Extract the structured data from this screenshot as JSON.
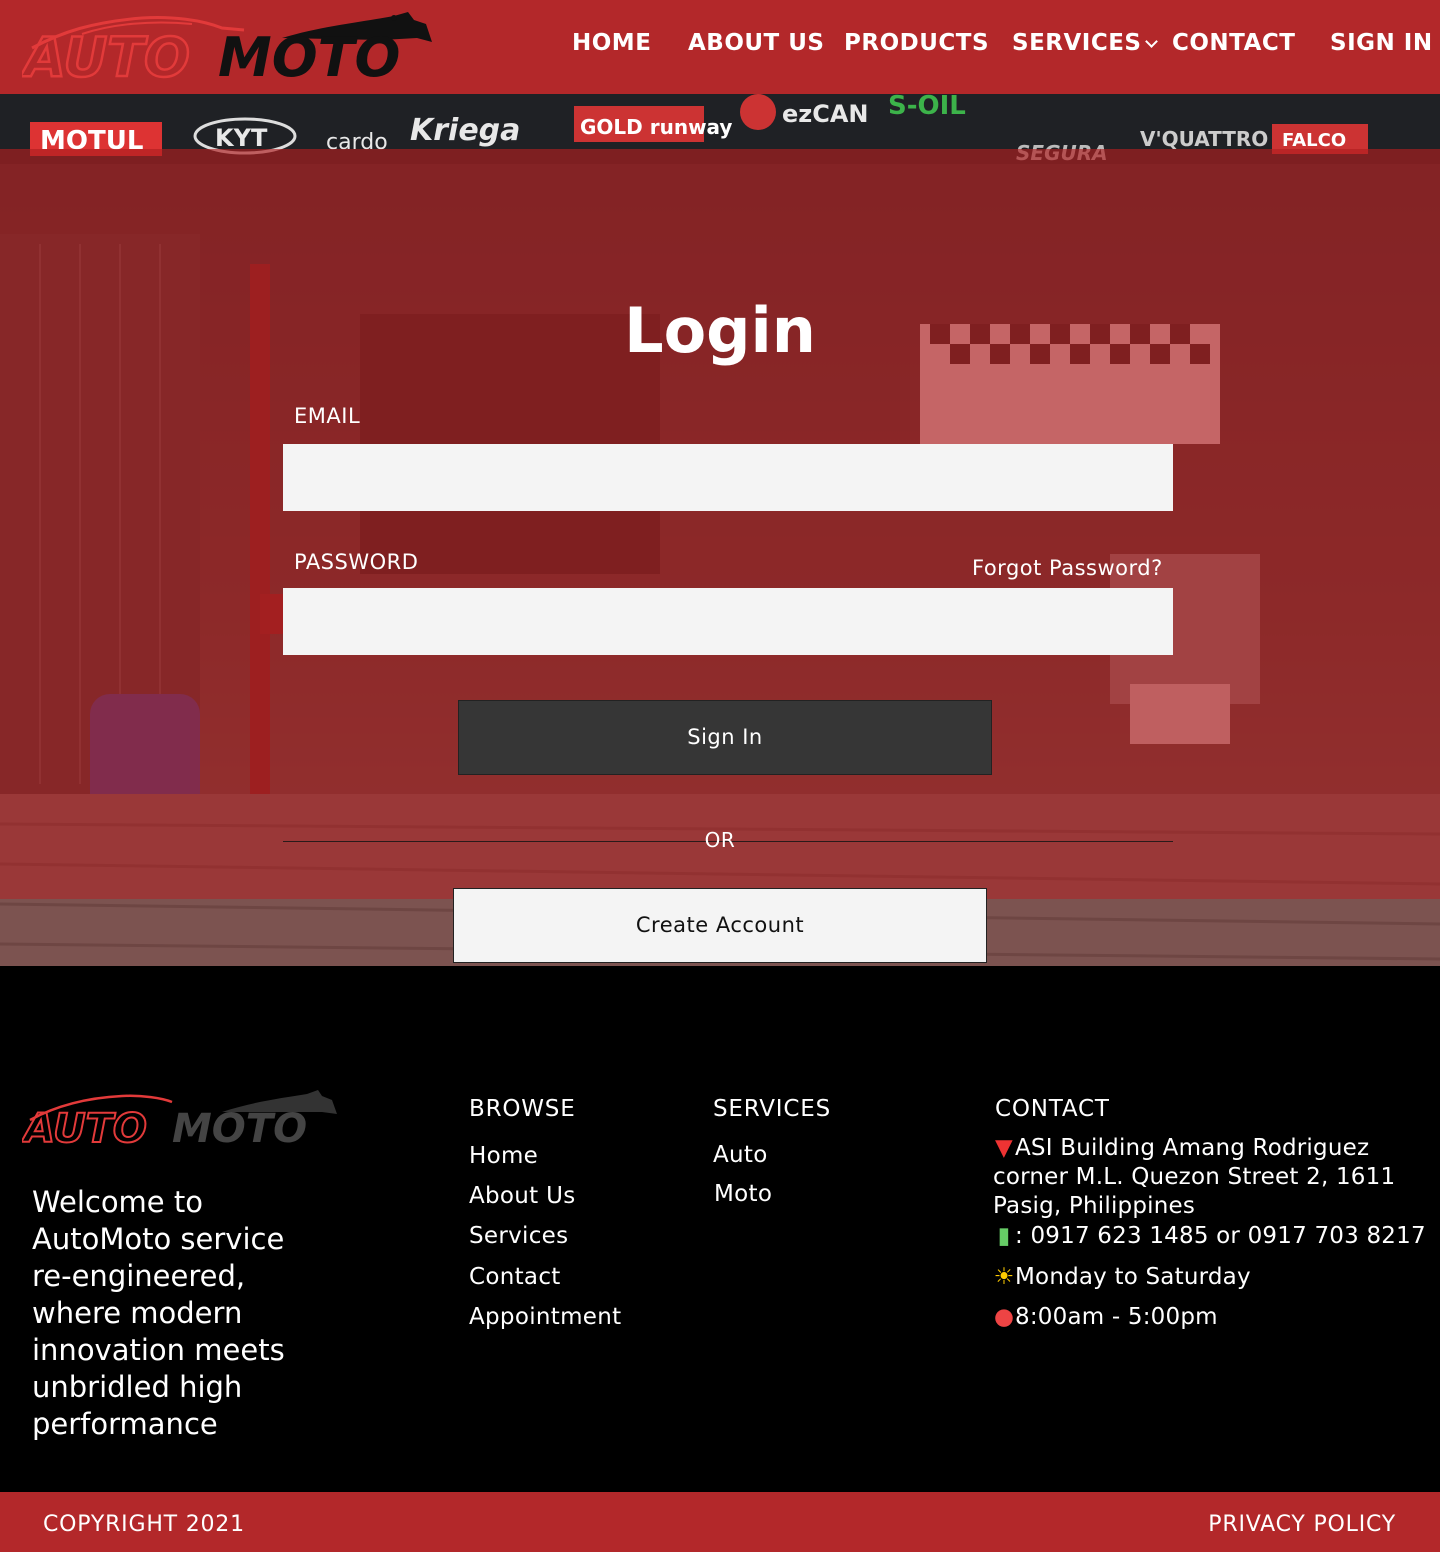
{
  "header": {
    "logo_text_auto": "AUTO",
    "logo_text_moto": "MOTO",
    "nav": {
      "home": "HOME",
      "about": "ABOUT US",
      "products": "PRODUCTS",
      "services": "SERVICES",
      "contact": "CONTACT",
      "signin": "SIGN IN"
    }
  },
  "hero": {
    "sponsors": [
      "MOTUL",
      "KYT",
      "cardo",
      "Kriega",
      "GOLD runway",
      "ezCAN",
      "S-OIL",
      "SEGURA",
      "V'QUATTRO",
      "FALCO"
    ]
  },
  "login": {
    "title": "Login",
    "email_label": "EMAIL",
    "email_value": "",
    "password_label": "PASSWORD",
    "password_value": "",
    "forgot_password": "Forgot Password?",
    "signin_button": "Sign In",
    "or_text": "OR",
    "create_account_button": "Create Account"
  },
  "footer": {
    "welcome": "Welcome to AutoMoto service re-engineered, where modern innovation meets unbridled high performance",
    "browse": {
      "heading": "BROWSE",
      "links": [
        "Home",
        "About Us",
        "Services",
        "Contact",
        "Appointment"
      ]
    },
    "services": {
      "heading": "SERVICES",
      "links": [
        "Auto",
        "Moto"
      ]
    },
    "contact": {
      "heading": "CONTACT",
      "address_line1": "ASI Building Amang Rodriguez",
      "address_line2": "corner M.L. Quezon Street 2, 1611",
      "address_line3": "Pasig, Philippines",
      "phone": ": 0917 623 1485 or 0917 703 8217",
      "days": "Monday to Saturday",
      "hours": "8:00am - 5:00pm",
      "icons": [
        "pin-icon",
        "phone-icon",
        "sun-icon",
        "alarm-clock-icon"
      ]
    },
    "copyright": "COPYRIGHT 2021",
    "privacy_policy": "PRIVACY POLICY"
  },
  "colors": {
    "brand_red": "#b3282a",
    "button_dark": "#363636",
    "field_bg": "#f4f4f4",
    "footer_bg": "#000000"
  }
}
